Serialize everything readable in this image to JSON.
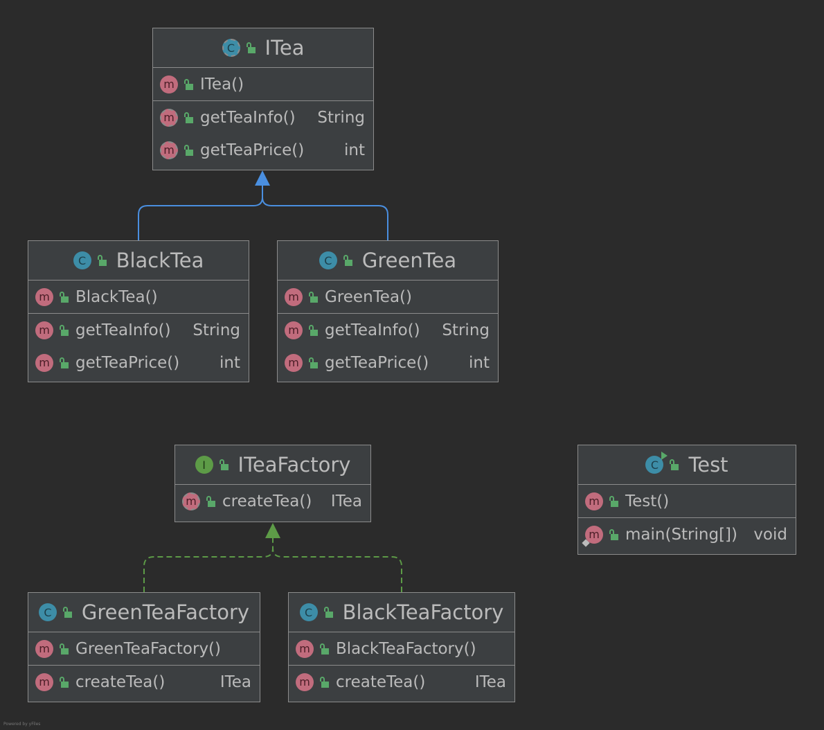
{
  "colors": {
    "background": "#2b2b2b",
    "class_fill": "#3c3f41",
    "border": "#8c8c8c",
    "extends_arrow": "#4a8fe0",
    "implements_arrow": "#5d9b47",
    "class_badge": "#3d8da7",
    "interface_badge": "#5d9b47",
    "method_badge": "#c16c7d",
    "public_lock": "#59a869"
  },
  "classes": {
    "itea": {
      "kind": "abstract-class",
      "badge": "C",
      "title": "ITea",
      "constructor": {
        "badge": "m",
        "name": "ITea()",
        "type": ""
      },
      "methods": [
        {
          "badge": "m",
          "abstract": true,
          "name": "getTeaInfo()",
          "type": "String"
        },
        {
          "badge": "m",
          "abstract": true,
          "name": "getTeaPrice()",
          "type": "int"
        }
      ]
    },
    "blacktea": {
      "kind": "class",
      "badge": "C",
      "title": "BlackTea",
      "constructor": {
        "badge": "m",
        "name": "BlackTea()",
        "type": ""
      },
      "methods": [
        {
          "badge": "m",
          "name": "getTeaInfo()",
          "type": "String"
        },
        {
          "badge": "m",
          "name": "getTeaPrice()",
          "type": "int"
        }
      ]
    },
    "greentea": {
      "kind": "class",
      "badge": "C",
      "title": "GreenTea",
      "constructor": {
        "badge": "m",
        "name": "GreenTea()",
        "type": ""
      },
      "methods": [
        {
          "badge": "m",
          "name": "getTeaInfo()",
          "type": "String"
        },
        {
          "badge": "m",
          "name": "getTeaPrice()",
          "type": "int"
        }
      ]
    },
    "iteafactory": {
      "kind": "interface",
      "badge": "I",
      "title": "ITeaFactory",
      "methods": [
        {
          "badge": "m",
          "abstract": true,
          "name": "createTea()",
          "type": "ITea"
        }
      ]
    },
    "test": {
      "kind": "runnable-class",
      "badge": "C",
      "title": "Test",
      "constructor": {
        "badge": "m",
        "name": "Test()",
        "type": ""
      },
      "methods": [
        {
          "badge": "m",
          "static": true,
          "name": "main(String[])",
          "type": "void"
        }
      ]
    },
    "greenteafactory": {
      "kind": "class",
      "badge": "C",
      "title": "GreenTeaFactory",
      "constructor": {
        "badge": "m",
        "name": "GreenTeaFactory()",
        "type": ""
      },
      "methods": [
        {
          "badge": "m",
          "name": "createTea()",
          "type": "ITea"
        }
      ]
    },
    "blackteafactory": {
      "kind": "class",
      "badge": "C",
      "title": "BlackTeaFactory",
      "constructor": {
        "badge": "m",
        "name": "BlackTeaFactory()",
        "type": ""
      },
      "methods": [
        {
          "badge": "m",
          "name": "createTea()",
          "type": "ITea"
        }
      ]
    }
  },
  "relations": [
    {
      "from": "BlackTea",
      "to": "ITea",
      "kind": "extends"
    },
    {
      "from": "GreenTea",
      "to": "ITea",
      "kind": "extends"
    },
    {
      "from": "GreenTeaFactory",
      "to": "ITeaFactory",
      "kind": "implements"
    },
    {
      "from": "BlackTeaFactory",
      "to": "ITeaFactory",
      "kind": "implements"
    }
  ],
  "footer": "Powered by yFiles"
}
